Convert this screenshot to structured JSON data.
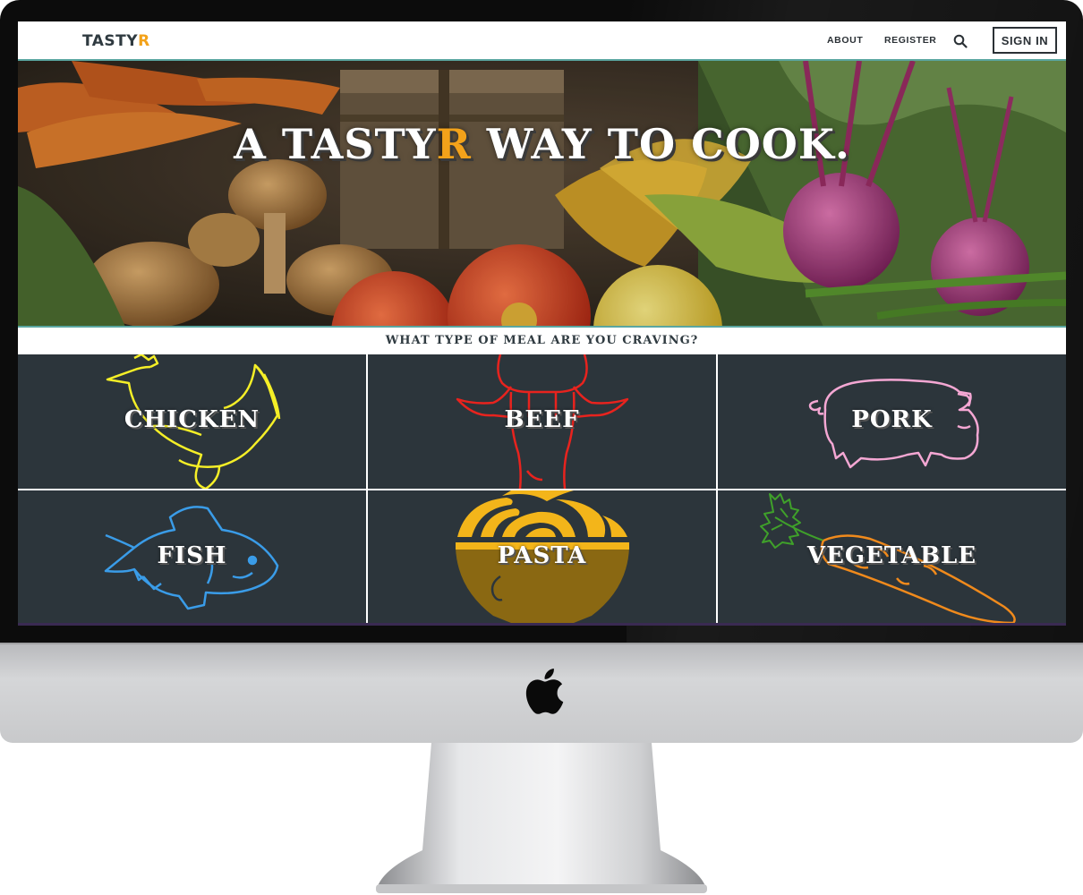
{
  "nav": {
    "logo_main": "TASTY",
    "logo_accent": "R",
    "links": [
      "ABOUT",
      "REGISTER"
    ],
    "signin_label": "SIGN IN",
    "search_icon": "search-icon"
  },
  "hero": {
    "title_before": "A TASTY",
    "title_accent": "R",
    "title_after": " WAY TO COOK."
  },
  "question": "WHAT TYPE OF MEAL ARE YOU CRAVING?",
  "categories": [
    {
      "label": "CHICKEN",
      "icon": "chicken-icon",
      "color": "#f5ef27"
    },
    {
      "label": "BEEF",
      "icon": "cow-icon",
      "color": "#e8231e"
    },
    {
      "label": "PORK",
      "icon": "pig-icon",
      "color": "#f4a7d3"
    },
    {
      "label": "FISH",
      "icon": "fish-icon",
      "color": "#3a9ce8"
    },
    {
      "label": "PASTA",
      "icon": "pasta-bowl-icon",
      "color": "#f3b51a"
    },
    {
      "label": "VEGETABLE",
      "icon": "carrot-icon",
      "color": "#f08a1c"
    }
  ],
  "colors": {
    "accent": "#f3a21a",
    "tile_bg": "#2c353b",
    "nav_text": "#2a3035",
    "teal_line": "#5aa6a0"
  }
}
